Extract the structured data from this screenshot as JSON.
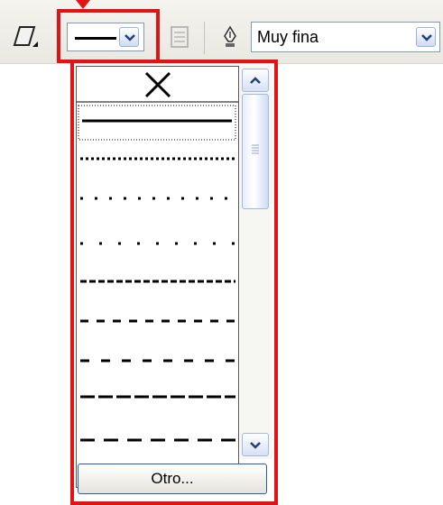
{
  "toolbar": {
    "line_style_selected": "solid",
    "line_width_value": "Muy fina",
    "icons": [
      "parallelogram-icon",
      "text-box-disabled-icon",
      "pen-nib-icon",
      "chevron-down-icon"
    ]
  },
  "dropdown": {
    "items": [
      {
        "style": "none"
      },
      {
        "style": "solid",
        "selected": true
      },
      {
        "style": "round-dot"
      },
      {
        "style": "square-dot"
      },
      {
        "style": "spaced-dot"
      },
      {
        "style": "dense-dash"
      },
      {
        "style": "dash"
      },
      {
        "style": "spaced-dash"
      },
      {
        "style": "long-dash"
      },
      {
        "style": "long-dash-spaced"
      }
    ],
    "other_button_label": "Otro..."
  },
  "colors": {
    "highlight": "#e01414",
    "selection": "#000000"
  }
}
